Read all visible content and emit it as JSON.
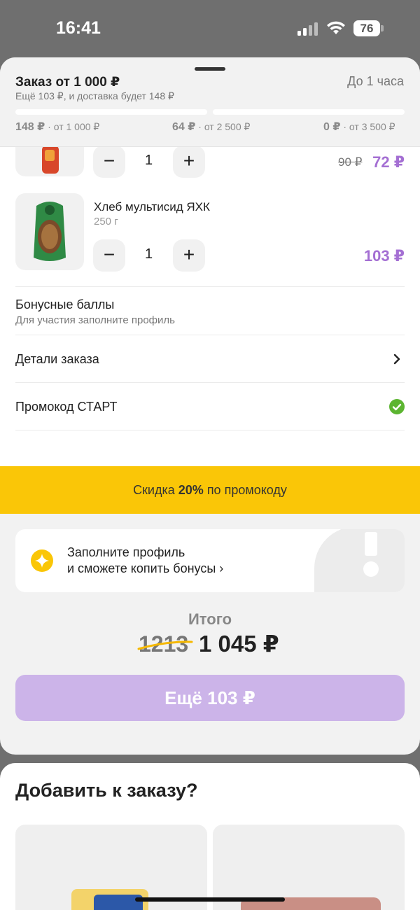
{
  "status_bar": {
    "time": "16:41",
    "battery": "76"
  },
  "order_header": {
    "title": "Заказ от 1 000 ₽",
    "subtitle": "Ещё 103 ₽, и доставка будет 148 ₽",
    "eta": "До 1 часа",
    "tiers": [
      {
        "fee": "148 ₽",
        "threshold": " · от 1 000 ₽"
      },
      {
        "fee": "64 ₽",
        "threshold": " · от 2 500 ₽"
      },
      {
        "fee": "0 ₽",
        "threshold": " · от 3 500 ₽"
      }
    ]
  },
  "products": [
    {
      "qty": "1",
      "old_price": "90 ₽",
      "price": "72 ₽",
      "thumb_color": "#d8472a"
    },
    {
      "name": "Хлеб мультисид ЯХК",
      "weight": "250 г",
      "qty": "1",
      "price": "103 ₽",
      "thumb_color": "#2f8a45"
    }
  ],
  "rows": {
    "bonus_title": "Бонусные баллы",
    "bonus_subtitle": "Для участия заполните профиль",
    "details_title": "Детали заказа",
    "promo_title": "Промокод СТАРТ"
  },
  "promo_banner": {
    "prefix": "Скидка ",
    "percent": "20%",
    "suffix": " по промокоду"
  },
  "profile_card": {
    "line1": "Заполните профиль",
    "line2": "и сможете копить бонусы ›"
  },
  "total": {
    "label": "Итого",
    "old": "1213",
    "new": "1 045 ₽"
  },
  "cta": {
    "label": "Ещё 103 ₽"
  },
  "upsell": {
    "title": "Добавить к заказу?"
  },
  "colors": {
    "accent_purple": "#a46fd3",
    "cta_disabled": "#ccb4e9",
    "promo_yellow": "#fac607",
    "success_green": "#5cb531"
  }
}
